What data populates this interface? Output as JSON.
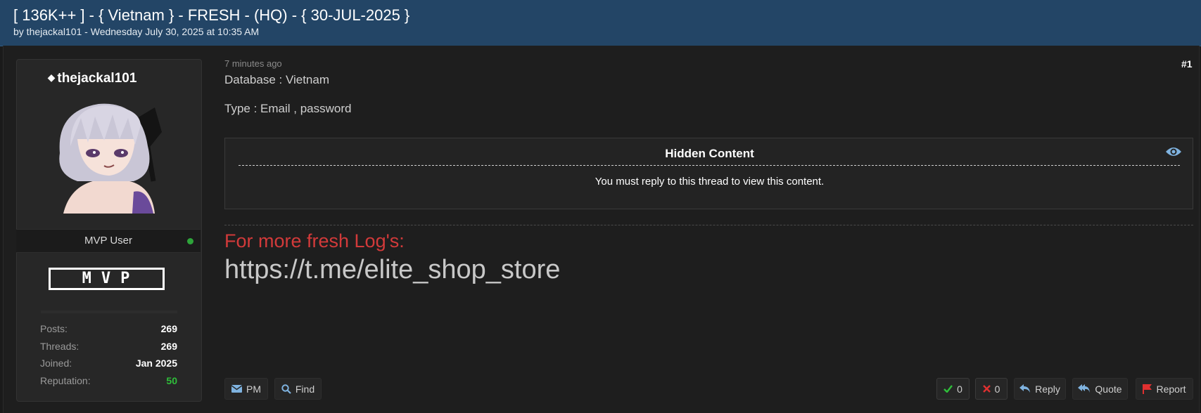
{
  "thread": {
    "title": "[ 136K++ ] - { Vietnam } - FRESH - (HQ) - { 30-JUL-2025 }",
    "meta": "by thejackal101 - Wednesday July 30, 2025 at 10:35 AM"
  },
  "user": {
    "username": "thejackal101",
    "title": "MVP User",
    "rank_badge": "MVP",
    "stats": [
      {
        "label": "Posts:",
        "value": "269"
      },
      {
        "label": "Threads:",
        "value": "269"
      },
      {
        "label": "Joined:",
        "value": "Jan 2025"
      },
      {
        "label": "Reputation:",
        "value": "50"
      }
    ]
  },
  "post": {
    "time": "7 minutes ago",
    "number": "#1",
    "lines": [
      "Database : Vietnam",
      "Type : Email , password"
    ],
    "hidden": {
      "title": "Hidden Content",
      "message": "You must reply to this thread to view this content."
    },
    "signature": {
      "line1": "For more fresh Log's:",
      "line2": "https://t.me/elite_shop_store"
    }
  },
  "actions": {
    "pm": "PM",
    "find": "Find",
    "upvotes": "0",
    "downvotes": "0",
    "reply": "Reply",
    "quote": "Quote",
    "report": "Report"
  },
  "colors": {
    "header_bg": "#234566",
    "signature_red": "#d23a3a",
    "online": "#2ea43a",
    "reputation": "#2fbf3a"
  },
  "icons": [
    "diamond-icon",
    "eye-icon",
    "envelope-icon",
    "search-icon",
    "check-icon",
    "x-icon",
    "reply-icon",
    "quote-icon",
    "flag-icon"
  ]
}
